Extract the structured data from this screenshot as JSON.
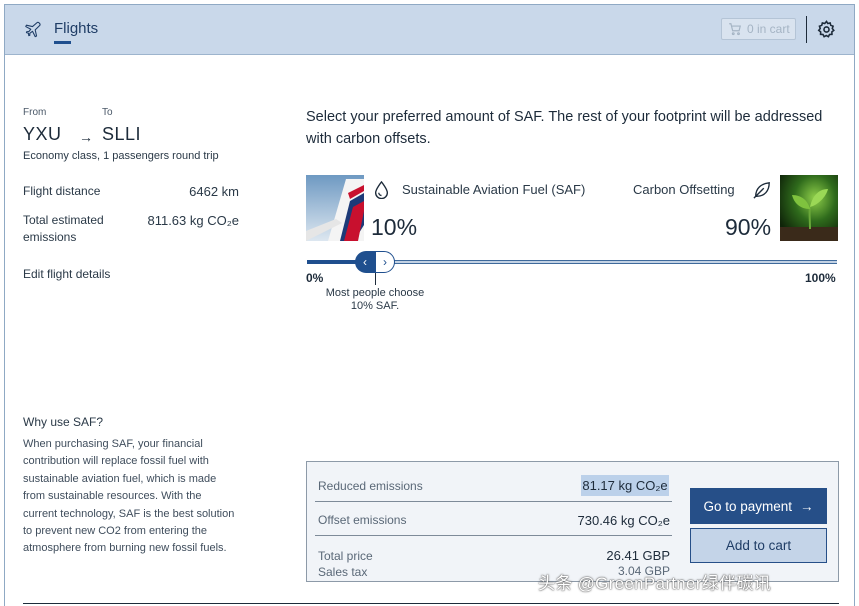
{
  "header": {
    "tab_label": "Flights",
    "cart_label": "0 in cart"
  },
  "trip": {
    "from_label": "From",
    "to_label": "To",
    "from_code": "YXU",
    "to_code": "SLLI",
    "class_info": "Economy class, 1 passengers round trip",
    "distance_label": "Flight distance",
    "distance_value": "6462 km",
    "emissions_label_line1": "Total estimated",
    "emissions_label_line2": "emissions",
    "emissions_value": "811.63 kg CO₂e",
    "edit_link": "Edit flight details"
  },
  "why": {
    "title": "Why use SAF?",
    "body": "When purchasing SAF, your financial contribution will replace fossil fuel with sustainable aviation fuel, which is made from sustainable resources. With the current technology, SAF is the best solution to prevent new CO2 from entering the atmosphere from burning new fossil fuels."
  },
  "selector": {
    "intro": "Select your preferred amount of SAF. The rest of your footprint will be addressed with carbon offsets.",
    "saf_label": "Sustainable Aviation Fuel (SAF)",
    "offset_label": "Carbon Offsetting",
    "saf_percent": "10%",
    "offset_percent": "90%",
    "slider_value": 0.1,
    "min_label": "0%",
    "max_label": "100%",
    "hint_line1": "Most people choose",
    "hint_line2": "10% SAF."
  },
  "summary": {
    "reduced_label": "Reduced emissions",
    "reduced_value": "81.17 kg CO₂e",
    "offset_label": "Offset emissions",
    "offset_value": "730.46 kg CO₂e",
    "price_label": "Total price",
    "price_value": "26.41 GBP",
    "tax_label": "Sales tax",
    "tax_value": "3.04 GBP",
    "pay_button": "Go to payment",
    "add_button": "Add to cart"
  },
  "watermark": "头条 @GreenPartner绿伴碳讯",
  "colors": {
    "header_bg": "#c9d8ea",
    "primary": "#264f88",
    "highlight": "#bcd1ea"
  }
}
